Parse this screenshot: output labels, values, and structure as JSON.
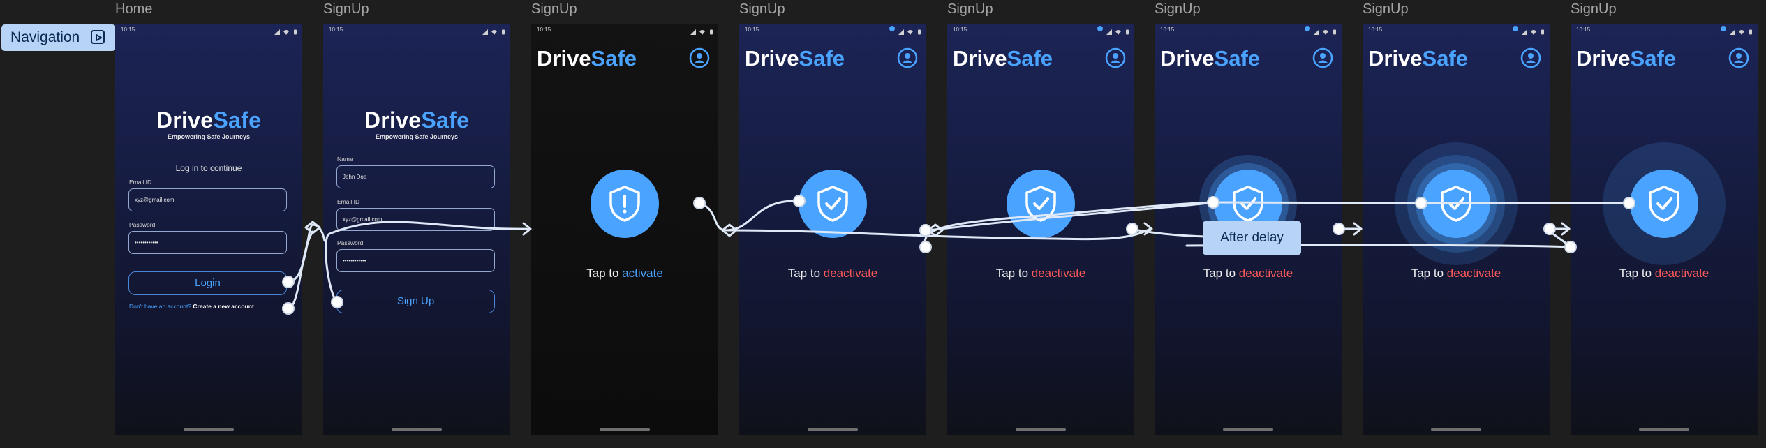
{
  "canvas": {
    "nav_label": "Navigation",
    "after_delay_label": "After delay"
  },
  "brand": {
    "drive": "Drive",
    "safe": "Safe"
  },
  "status_time": "10:15",
  "frames": [
    {
      "title": "Home",
      "tagline": "Empowering Safe Journeys",
      "prompt": "Log in to continue",
      "fields": [
        {
          "label": "Email ID",
          "value": "xyz@gmail.com"
        },
        {
          "label": "Password",
          "value": "••••••••••••"
        }
      ],
      "button_label": "Login",
      "footer_text": "Don't have an account?",
      "footer_link": "Create a new account"
    },
    {
      "title": "SignUp",
      "tagline": "Empowering Safe Journeys",
      "fields": [
        {
          "label": "Name",
          "value": "John Doe"
        },
        {
          "label": "Email ID",
          "value": "xyz@gmail.com"
        },
        {
          "label": "Password",
          "value": "••••••••••••"
        }
      ],
      "button_label": "Sign Up"
    },
    {
      "title": "SignUp",
      "tap_prefix": "Tap to",
      "tap_action": "activate",
      "state": "alert",
      "icon": "shield-alert-icon"
    },
    {
      "title": "SignUp",
      "tap_prefix": "Tap to",
      "tap_action": "deactivate",
      "state": "active",
      "icon": "shield-check-icon"
    },
    {
      "title": "SignUp",
      "tap_prefix": "Tap to",
      "tap_action": "deactivate",
      "state": "active",
      "icon": "shield-check-icon"
    },
    {
      "title": "SignUp",
      "tap_prefix": "Tap to",
      "tap_action": "deactivate",
      "state": "active",
      "icon": "shield-check-icon"
    },
    {
      "title": "SignUp",
      "tap_prefix": "Tap to",
      "tap_action": "deactivate",
      "state": "active",
      "icon": "shield-check-icon"
    },
    {
      "title": "SignUp",
      "tap_prefix": "Tap to",
      "tap_action": "deactivate",
      "state": "active",
      "icon": "shield-check-icon"
    }
  ],
  "colors": {
    "accent": "#4aa3ff",
    "danger": "#ff5a5a",
    "prototype_wire": "#dfe9f7",
    "canvas_bg": "#1e1e1e",
    "label_bg": "#b7d4f7"
  }
}
